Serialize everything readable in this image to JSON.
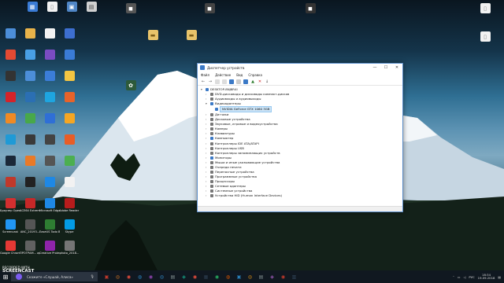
{
  "desktop": {
    "icons": [
      {
        "label": "",
        "color": "#3a7bd5",
        "glyph": "▦"
      },
      {
        "label": "",
        "color": "#f4c542",
        "glyph": "▤"
      },
      {
        "label": "",
        "color": "#f2f2f2",
        "glyph": "▯"
      },
      {
        "label": "",
        "color": "#3a7bd5",
        "glyph": "▣"
      },
      {
        "label": "",
        "color": "#d9d9d9",
        "glyph": "◼"
      },
      {
        "label": "",
        "color": "#6a6a6a",
        "glyph": "◼"
      },
      {
        "label": "",
        "color": "#6a6a6a",
        "glyph": "◼"
      },
      {
        "label": "",
        "color": "#f2f2f2",
        "glyph": "▯"
      }
    ],
    "left_icons": [
      {
        "label": "",
        "color": "#4c8ed9"
      },
      {
        "label": "",
        "color": "#e8b34a"
      },
      {
        "label": "",
        "color": "#f2f2f2"
      },
      {
        "label": "",
        "color": "#3d6fd0"
      },
      {
        "label": "",
        "color": "#e34a33"
      },
      {
        "label": "",
        "color": "#49a0e6"
      },
      {
        "label": "",
        "color": "#7a4cc2"
      },
      {
        "label": "",
        "color": "#3a7bd5"
      },
      {
        "label": "",
        "color": "#333"
      },
      {
        "label": "",
        "color": "#4c8ed9"
      },
      {
        "label": "",
        "color": "#3b7dd8"
      },
      {
        "label": "",
        "color": "#f4c542"
      },
      {
        "label": "",
        "color": "#d4232a"
      },
      {
        "label": "",
        "color": "#2b6fb3"
      },
      {
        "label": "",
        "color": "#1ea5e0"
      },
      {
        "label": "",
        "color": "#e7632a"
      },
      {
        "label": "",
        "color": "#f08a24"
      },
      {
        "label": "",
        "color": "#48a84a"
      },
      {
        "label": "",
        "color": "#2f6fd6"
      },
      {
        "label": "",
        "color": "#f5a623"
      },
      {
        "label": "",
        "color": "#1f9ad6"
      },
      {
        "label": "",
        "color": "#3a3a3a"
      },
      {
        "label": "",
        "color": "#444"
      },
      {
        "label": "",
        "color": "#e85d27"
      },
      {
        "label": "",
        "color": "#1b2838"
      },
      {
        "label": "",
        "color": "#e97a28"
      },
      {
        "label": "",
        "color": "#555"
      },
      {
        "label": "",
        "color": "#4caf50"
      },
      {
        "label": "",
        "color": "#c0392b"
      },
      {
        "label": "",
        "color": "#222"
      },
      {
        "label": "",
        "color": "#1e88e5"
      },
      {
        "label": "",
        "color": "#f2f2f2"
      },
      {
        "label": "Браузер Opera",
        "color": "#d32f2f"
      },
      {
        "label": "АСЕ64 Extreme",
        "color": "#c62828"
      },
      {
        "label": "Microsoft Edge",
        "color": "#1e88e5"
      },
      {
        "label": "Adobe Reader DC",
        "color": "#b71c1c"
      },
      {
        "label": "Screencast",
        "color": "#2196f3"
      },
      {
        "label": "ANC_20193...",
        "color": "#555"
      },
      {
        "label": "EaseUS Todo Backup Fre...",
        "color": "#2e7d32"
      },
      {
        "label": "Skype",
        "color": "#039be5"
      },
      {
        "label": "Google Chrome",
        "color": "#e53935"
      },
      {
        "label": "ПРОГРАМ... архив (2)",
        "color": "#616161"
      },
      {
        "label": "Creative Proiect Ed...",
        "color": "#8e24aa"
      },
      {
        "label": "photo_2018...",
        "color": "#757575"
      }
    ]
  },
  "window": {
    "title": "Диспетчер устройств",
    "controls": {
      "minimize": "—",
      "maximize": "☐",
      "close": "✕"
    },
    "menu": [
      "Файл",
      "Действие",
      "Вид",
      "Справка"
    ],
    "tree": [
      {
        "text": "DESKTOP-8NJ8R4I",
        "level": 0,
        "arrow": "▾",
        "color": "#3b79c6"
      },
      {
        "text": "DVD-дисководы и дисководы компакт-дисков",
        "level": 1,
        "arrow": "›",
        "color": "#777"
      },
      {
        "text": "Аудиовходы и аудиовыходы",
        "level": 1,
        "arrow": "›",
        "color": "#777"
      },
      {
        "text": "Видеоадаптеры",
        "level": 1,
        "arrow": "▾",
        "color": "#3b79c6"
      },
      {
        "text": "NVIDIA GeForce GTX 1060 3GB",
        "level": 2,
        "arrow": "",
        "color": "#3b79c6",
        "selected": true
      },
      {
        "text": "Датчики",
        "level": 1,
        "arrow": "›",
        "color": "#777"
      },
      {
        "text": "Дисковые устройства",
        "level": 1,
        "arrow": "›",
        "color": "#777"
      },
      {
        "text": "Звуковые, игровые и видеоустройства",
        "level": 1,
        "arrow": "›",
        "color": "#777"
      },
      {
        "text": "Камеры",
        "level": 1,
        "arrow": "›",
        "color": "#777"
      },
      {
        "text": "Клавиатуры",
        "level": 1,
        "arrow": "›",
        "color": "#777"
      },
      {
        "text": "Компьютер",
        "level": 1,
        "arrow": "›",
        "color": "#3b79c6"
      },
      {
        "text": "Контроллеры IDE ATA/ATAPI",
        "level": 1,
        "arrow": "›",
        "color": "#777"
      },
      {
        "text": "Контроллеры USB",
        "level": 1,
        "arrow": "›",
        "color": "#777"
      },
      {
        "text": "Контроллеры запоминающих устройств",
        "level": 1,
        "arrow": "›",
        "color": "#777"
      },
      {
        "text": "Мониторы",
        "level": 1,
        "arrow": "›",
        "color": "#3b79c6"
      },
      {
        "text": "Мыши и иные указывающие устройства",
        "level": 1,
        "arrow": "›",
        "color": "#777"
      },
      {
        "text": "Очереди печати",
        "level": 1,
        "arrow": "›",
        "color": "#777"
      },
      {
        "text": "Переносные устройства",
        "level": 1,
        "arrow": "›",
        "color": "#777"
      },
      {
        "text": "Программные устройства",
        "level": 1,
        "arrow": "›",
        "color": "#777"
      },
      {
        "text": "Процессоры",
        "level": 1,
        "arrow": "›",
        "color": "#777"
      },
      {
        "text": "Сетевые адаптеры",
        "level": 1,
        "arrow": "›",
        "color": "#777"
      },
      {
        "text": "Системные устройства",
        "level": 1,
        "arrow": "›",
        "color": "#777"
      },
      {
        "text": "Устройства HID (Human Interface Devices)",
        "level": 1,
        "arrow": "›",
        "color": "#777"
      }
    ]
  },
  "taskbar": {
    "search_placeholder": "Скажите «Слушай, Алиса»",
    "time": "18:34",
    "date": "19.09.2018",
    "language": "РУС",
    "apps": [
      "▣",
      "◎",
      "◉",
      "◍",
      "◉",
      "◎",
      "▤",
      "◈",
      "◉",
      "▦",
      "◉",
      "◍",
      "▣",
      "◎",
      "▤",
      "◈",
      "◉",
      "▥"
    ]
  },
  "watermark": {
    "line1": "RECORDED WITH",
    "line2": "SCREENCAST",
    "line3": "MATIC"
  }
}
